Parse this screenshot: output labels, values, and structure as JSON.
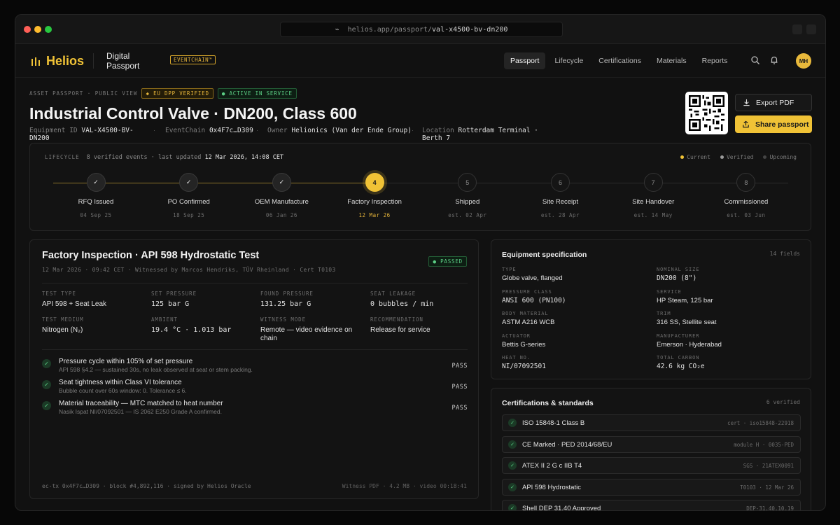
{
  "browser": {
    "url_prefix": "⌁",
    "url_host": "helios.app/passport/",
    "url_path": "val-x4500-bv-dn200"
  },
  "brand": {
    "name": "Helios",
    "subtitle": "Digital Passport",
    "badge": "EVENTCHAIN™",
    "accent": "#f0c236"
  },
  "nav": {
    "tabs": [
      "Passport",
      "Lifecycle",
      "Certifications",
      "Materials",
      "Reports"
    ],
    "active": 0,
    "avatar": "MH"
  },
  "asset": {
    "label": "ASSET PASSPORT · PUBLIC VIEW",
    "badges": [
      "EU DPP VERIFIED",
      "ACTIVE IN SERVICE"
    ],
    "title": "Industrial Control Valve · DN200, Class 600",
    "equipment_label": "Equipment ID",
    "equipment_value": "VAL-X4500-BV-DN200",
    "eventchain_label": "EventChain",
    "eventchain_value": "0x4F7c…D309",
    "owner_label": "Owner",
    "owner_value": "Helionics (Van der Ende Group)",
    "location_label": "Location",
    "location_value": "Rotterdam Terminal · Berth 7",
    "export_label": "Export PDF",
    "share_label": "Share passport"
  },
  "lifecycle": {
    "caption": "LIFECYCLE",
    "events": "8 verified events · last updated",
    "updated": "12 Mar 2026, 14:08 CET",
    "legend": [
      "Current",
      "Verified",
      "Upcoming"
    ],
    "steps": [
      {
        "mark": "✓",
        "label": "RFQ Issued",
        "date": "04 Sep 25",
        "state": "done"
      },
      {
        "mark": "✓",
        "label": "PO Confirmed",
        "date": "18 Sep 25",
        "state": "done"
      },
      {
        "mark": "✓",
        "label": "OEM Manufacture",
        "date": "06 Jan 26",
        "state": "done"
      },
      {
        "mark": "4",
        "label": "Factory Inspection",
        "date": "12 Mar 26",
        "state": "current"
      },
      {
        "mark": "5",
        "label": "Shipped",
        "date": "est. 02 Apr",
        "state": "upcoming"
      },
      {
        "mark": "6",
        "label": "Site Receipt",
        "date": "est. 28 Apr",
        "state": "upcoming"
      },
      {
        "mark": "7",
        "label": "Site Handover",
        "date": "est. 14 May",
        "state": "upcoming"
      },
      {
        "mark": "8",
        "label": "Commissioned",
        "date": "est. 03 Jun",
        "state": "upcoming"
      }
    ]
  },
  "inspection": {
    "title": "Factory Inspection · API 598 Hydrostatic Test",
    "meta": "12 Mar 2026 · 09:42 CET   ·   Witnessed by Marcos Hendriks, TÜV Rheinland   ·   Cert T0103",
    "status": "PASSED",
    "fields": [
      {
        "label": "TEST TYPE",
        "value": "API 598 + Seat Leak"
      },
      {
        "label": "SET PRESSURE",
        "value": "125 bar G"
      },
      {
        "label": "FOUND PRESSURE",
        "value": "131.25 bar G"
      },
      {
        "label": "SEAT LEAKAGE",
        "value": "0 bubbles / min"
      },
      {
        "label": "TEST MEDIUM",
        "value": "Nitrogen (N₂)"
      },
      {
        "label": "AMBIENT",
        "value": "19.4 °C · 1.013 bar"
      },
      {
        "label": "WITNESS MODE",
        "value": "Remote — video evidence on chain"
      },
      {
        "label": "RECOMMENDATION",
        "value": "Release for service"
      }
    ],
    "checks": [
      {
        "title": "Pressure cycle within 105% of set pressure",
        "sub": "API 598 §4.2 — sustained 30s, no leak observed at seat or stem packing.",
        "result": "PASS"
      },
      {
        "title": "Seat tightness within Class VI tolerance",
        "sub": "Bubble count over 60s window: 0. Tolerance ≤ 6.",
        "result": "PASS"
      },
      {
        "title": "Material traceability — MTC matched to heat number",
        "sub": "Nasik Ispat NI/07092501 — IS 2062 E250 Grade A confirmed.",
        "result": "PASS"
      }
    ],
    "footer_left": "ec-tx 0x4F7c…D309 · block #4,892,116 · signed by Helios Oracle",
    "footer_right": "Witness PDF · 4.2 MB · video 00:18:41"
  },
  "spec": {
    "title": "Equipment specification",
    "count": "14 fields",
    "fields": [
      {
        "label": "TYPE",
        "value": "Globe valve, flanged"
      },
      {
        "label": "NOMINAL SIZE",
        "value": "DN200 (8\")"
      },
      {
        "label": "PRESSURE CLASS",
        "value": "ANSI 600 (PN100)"
      },
      {
        "label": "SERVICE",
        "value": "HP Steam, 125 bar"
      },
      {
        "label": "BODY MATERIAL",
        "value": "ASTM A216 WCB"
      },
      {
        "label": "TRIM",
        "value": "316 SS, Stellite seat"
      },
      {
        "label": "ACTUATOR",
        "value": "Bettis G-series"
      },
      {
        "label": "MANUFACTURER",
        "value": "Emerson · Hyderabad"
      },
      {
        "label": "HEAT NO.",
        "value": "NI/07092501"
      },
      {
        "label": "TOTAL CARBON",
        "value": "42.6 kg CO₂e"
      }
    ]
  },
  "certs": {
    "title": "Certifications & standards",
    "count": "6 verified",
    "items": [
      {
        "name": "ISO 15848-1 Class B",
        "ref": "cert · iso15848-22918"
      },
      {
        "name": "CE Marked · PED 2014/68/EU",
        "ref": "module H · 0035-PED"
      },
      {
        "name": "ATEX II 2 G c IIB T4",
        "ref": "SGS · 21ATEX0091"
      },
      {
        "name": "API 598 Hydrostatic",
        "ref": "T0103 · 12 Mar 26"
      },
      {
        "name": "Shell DEP 31.40 Approved",
        "ref": "DEP-31.40.10.19"
      }
    ]
  }
}
